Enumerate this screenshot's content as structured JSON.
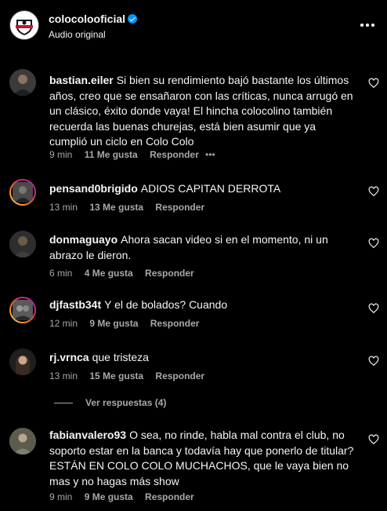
{
  "header": {
    "account": "colocolooficial",
    "subtitle": "Audio original"
  },
  "comments": [
    {
      "user": "bastian.eiler",
      "text": "Si bien su rendimiento bajó bastante los últimos años, creo que se ensañaron con las críticas, nunca arrugó en un clásico, éxito donde vaya! El hincha colocolino también recuerda las buenas churejas, está bien asumir que ya cumplió un ciclo en Colo Colo",
      "time": "9 min",
      "likes": "11 Me gusta",
      "reply": "Responder"
    },
    {
      "user": "pensand0brigido",
      "text": "ADIOS CAPITAN DERROTA",
      "time": "13 min",
      "likes": "13 Me gusta",
      "reply": "Responder"
    },
    {
      "user": "donmaguayo",
      "text": "Ahora sacan video si en el momento, ni un abrazo le dieron.",
      "time": "6 min",
      "likes": "4 Me gusta",
      "reply": "Responder"
    },
    {
      "user": "djfastb34t",
      "text": "Y el de bolados? Cuando",
      "time": "12 min",
      "likes": "9 Me gusta",
      "reply": "Responder"
    },
    {
      "user": "rj.vrnca",
      "text": "que tristeza",
      "time": "13 min",
      "likes": "15 Me gusta",
      "reply": "Responder"
    },
    {
      "user": "fabianvalero93",
      "text": "O sea, no rinde, habla mal contra el club, no soporto estar en la banca y todavía hay que ponerlo de titular? ESTÁN EN COLO COLO MUCHACHOS, que le vaya bien no mas y no hagas más show",
      "time": "9 min",
      "likes": "9 Me gusta",
      "reply": "Responder"
    }
  ],
  "view_replies": "Ver respuestas (4)"
}
